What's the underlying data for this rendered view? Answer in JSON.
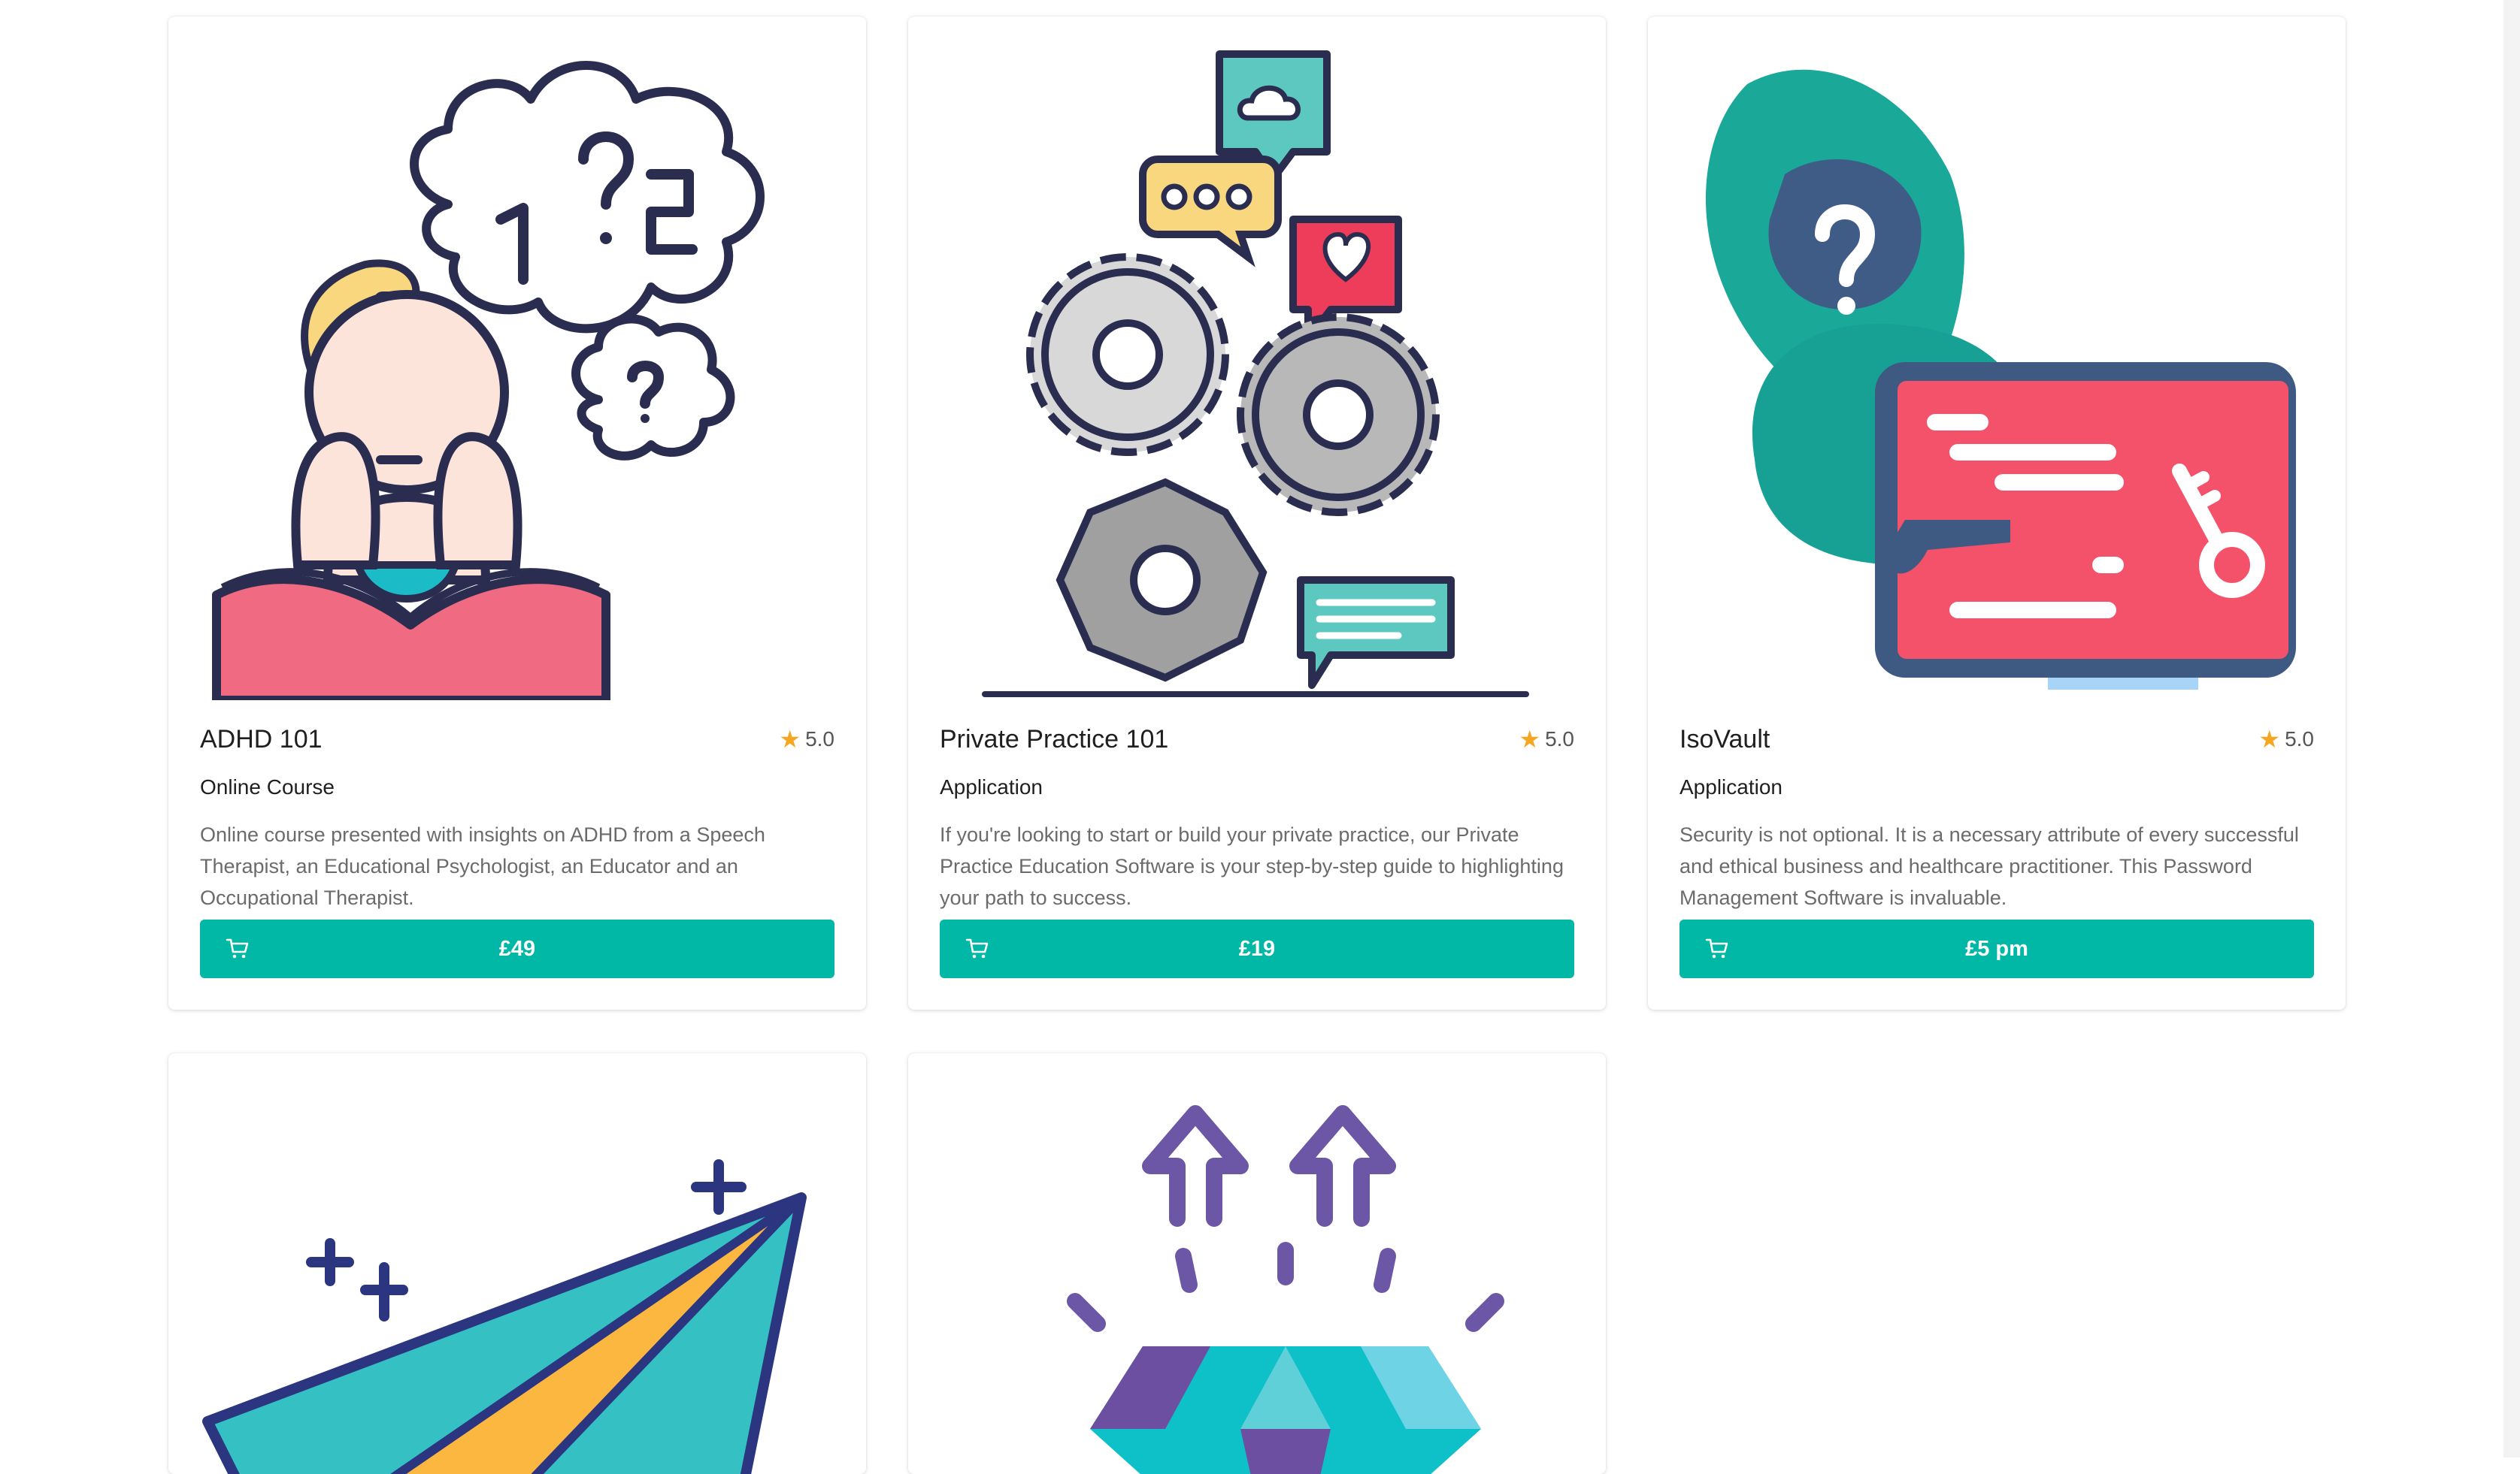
{
  "products": [
    {
      "title": "ADHD 101",
      "rating": "5.0",
      "type": "Online Course",
      "description": "Online course presented with insights on ADHD from a Speech Therapist, an Educational Psychologist, an Educator and an Occupational Therapist.",
      "price": "£49",
      "illustration": "girl-reading-thinking-icon"
    },
    {
      "title": "Private Practice 101",
      "rating": "5.0",
      "type": "Application",
      "description": "If you're looking to start or build your private practice, our Private Practice Education Software is your step-by-step guide to highlighting your path to success.",
      "price": "£19",
      "illustration": "gears-speech-bubbles-icon"
    },
    {
      "title": "IsoVault",
      "rating": "5.0",
      "type": "Application",
      "description": "Security is not optional. It is a necessary attribute of every successful and ethical business and healthcare practitioner. This Password Management Software is invaluable.",
      "price": "£5 pm",
      "illustration": "hooded-figure-key-icon"
    },
    {
      "illustration": "paper-plane-icon"
    },
    {
      "illustration": "diamond-arrows-icon"
    }
  ],
  "colors": {
    "accent": "#00b8a5",
    "star": "#f5a623"
  }
}
